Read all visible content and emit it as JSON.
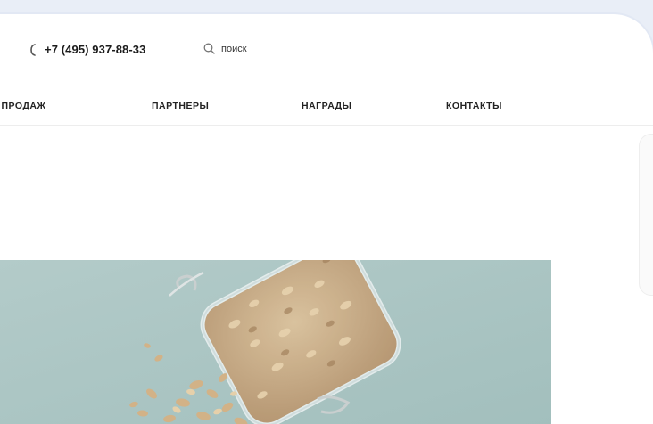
{
  "header": {
    "phone": "+7 (495) 937-88-33",
    "search_placeholder": "поиск"
  },
  "nav": {
    "items": [
      {
        "label": "А ПРОДАЖ"
      },
      {
        "label": "ПАРТНЕРЫ"
      },
      {
        "label": "НАГРАДЫ"
      },
      {
        "label": "КОНТАКТЫ"
      }
    ]
  },
  "colors": {
    "page_bg": "#e9eef7",
    "card_bg": "#ffffff",
    "photo_bg": "#a9c3c1",
    "oat": "#d2b287"
  },
  "icons": [
    "phone-icon",
    "search-icon"
  ]
}
